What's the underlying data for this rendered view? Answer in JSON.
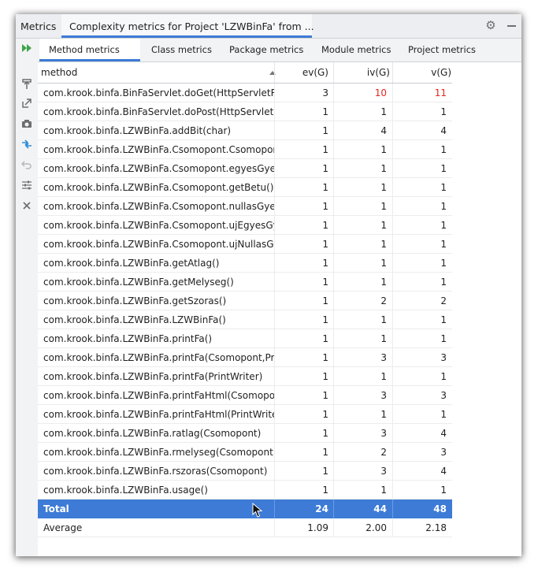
{
  "window": {
    "panel_title": "Metrics",
    "tab_title": "Complexity metrics for Project 'LZWBinFa' from ..."
  },
  "tabs": [
    {
      "label": "Method metrics",
      "active": true
    },
    {
      "label": "Class metrics",
      "active": false
    },
    {
      "label": "Package metrics",
      "active": false
    },
    {
      "label": "Module metrics",
      "active": false
    },
    {
      "label": "Project metrics",
      "active": false
    }
  ],
  "toolbar_icons": [
    "run-icon",
    "pin-icon",
    "export-icon",
    "camera-icon",
    "diff-icon",
    "undo-icon",
    "settings-sliders-icon",
    "close-icon"
  ],
  "columns": {
    "method": "method",
    "ev": "ev(G)",
    "iv": "iv(G)",
    "v": "v(G)"
  },
  "rows": [
    {
      "method": "com.krook.binfa.BinFaServlet.doGet(HttpServletRequest,HttpServletResponse)",
      "ev": "3",
      "iv": "10",
      "v": "11",
      "iv_red": true,
      "v_red": true
    },
    {
      "method": "com.krook.binfa.BinFaServlet.doPost(HttpServletRequest,HttpServletResponse)",
      "ev": "1",
      "iv": "1",
      "v": "1"
    },
    {
      "method": "com.krook.binfa.LZWBinFa.addBit(char)",
      "ev": "1",
      "iv": "4",
      "v": "4"
    },
    {
      "method": "com.krook.binfa.LZWBinFa.Csomopont.Csomopont(char)",
      "ev": "1",
      "iv": "1",
      "v": "1"
    },
    {
      "method": "com.krook.binfa.LZWBinFa.Csomopont.egyesGyermek()",
      "ev": "1",
      "iv": "1",
      "v": "1"
    },
    {
      "method": "com.krook.binfa.LZWBinFa.Csomopont.getBetu()",
      "ev": "1",
      "iv": "1",
      "v": "1"
    },
    {
      "method": "com.krook.binfa.LZWBinFa.Csomopont.nullasGyermek()",
      "ev": "1",
      "iv": "1",
      "v": "1"
    },
    {
      "method": "com.krook.binfa.LZWBinFa.Csomopont.ujEgyesGyermek(Csomopont)",
      "ev": "1",
      "iv": "1",
      "v": "1"
    },
    {
      "method": "com.krook.binfa.LZWBinFa.Csomopont.ujNullasGyermek(Csomopont)",
      "ev": "1",
      "iv": "1",
      "v": "1"
    },
    {
      "method": "com.krook.binfa.LZWBinFa.getAtlag()",
      "ev": "1",
      "iv": "1",
      "v": "1"
    },
    {
      "method": "com.krook.binfa.LZWBinFa.getMelyseg()",
      "ev": "1",
      "iv": "1",
      "v": "1"
    },
    {
      "method": "com.krook.binfa.LZWBinFa.getSzoras()",
      "ev": "1",
      "iv": "2",
      "v": "2"
    },
    {
      "method": "com.krook.binfa.LZWBinFa.LZWBinFa()",
      "ev": "1",
      "iv": "1",
      "v": "1"
    },
    {
      "method": "com.krook.binfa.LZWBinFa.printFa()",
      "ev": "1",
      "iv": "1",
      "v": "1"
    },
    {
      "method": "com.krook.binfa.LZWBinFa.printFa(Csomopont,PrintWriter)",
      "ev": "1",
      "iv": "3",
      "v": "3"
    },
    {
      "method": "com.krook.binfa.LZWBinFa.printFa(PrintWriter)",
      "ev": "1",
      "iv": "1",
      "v": "1"
    },
    {
      "method": "com.krook.binfa.LZWBinFa.printFaHtml(Csomopont,PrintWriter)",
      "ev": "1",
      "iv": "3",
      "v": "3"
    },
    {
      "method": "com.krook.binfa.LZWBinFa.printFaHtml(PrintWriter)",
      "ev": "1",
      "iv": "1",
      "v": "1"
    },
    {
      "method": "com.krook.binfa.LZWBinFa.ratlag(Csomopont)",
      "ev": "1",
      "iv": "3",
      "v": "4"
    },
    {
      "method": "com.krook.binfa.LZWBinFa.rmelyseg(Csomopont)",
      "ev": "1",
      "iv": "2",
      "v": "3"
    },
    {
      "method": "com.krook.binfa.LZWBinFa.rszoras(Csomopont)",
      "ev": "1",
      "iv": "3",
      "v": "4"
    },
    {
      "method": "com.krook.binfa.LZWBinFa.usage()",
      "ev": "1",
      "iv": "1",
      "v": "1"
    }
  ],
  "total": {
    "label": "Total",
    "ev": "24",
    "iv": "44",
    "v": "48"
  },
  "average": {
    "label": "Average",
    "ev": "1.09",
    "iv": "2.00",
    "v": "2.18"
  },
  "colors": {
    "accent": "#3d7bd6",
    "red_value": "#e8261e"
  }
}
